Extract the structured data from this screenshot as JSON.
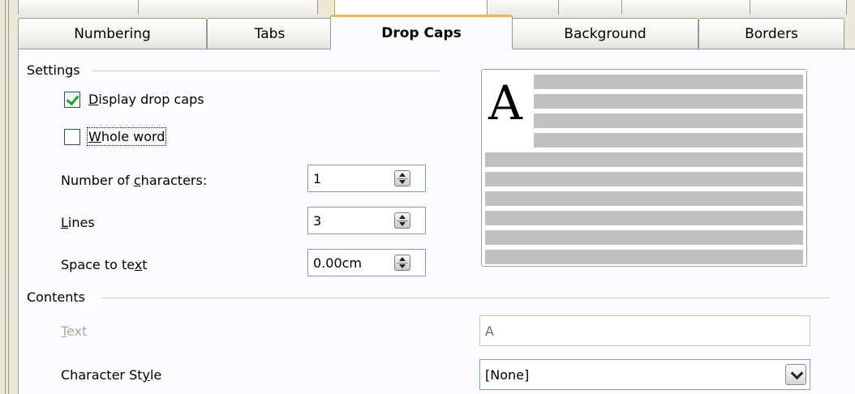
{
  "tabs": [
    {
      "label": "Numbering"
    },
    {
      "label": "Tabs"
    },
    {
      "label": "Drop Caps"
    },
    {
      "label": "Background"
    },
    {
      "label": "Borders"
    }
  ],
  "active_tab": "Drop Caps",
  "settings": {
    "group_label": "Settings",
    "display_drop_caps": {
      "label_accel": "D",
      "label_rest": "isplay drop caps",
      "checked": true
    },
    "whole_word": {
      "label_accel": "W",
      "label_rest": "hole word",
      "checked": false
    },
    "number_of_characters": {
      "label_pre": "Number of ",
      "label_accel": "c",
      "label_post": "haracters:",
      "value": "1"
    },
    "lines": {
      "label_accel": "L",
      "label_rest": "ines",
      "value": "3"
    },
    "space_to_text": {
      "label_pre": "Space to te",
      "label_accel": "x",
      "label_post": "t",
      "value": "0.00cm"
    }
  },
  "preview": {
    "letter": "A"
  },
  "contents": {
    "group_label": "Contents",
    "text": {
      "label_accel": "T",
      "label_rest": "ext",
      "value": "A",
      "disabled": true
    },
    "character_style": {
      "label_pre": "Character St",
      "label_accel": "y",
      "label_post": "le",
      "value": "[None]"
    }
  },
  "colors": {
    "accent_tab": "#f7b53c",
    "check": "#21a121",
    "panel_bg": "#fcfcfe"
  }
}
